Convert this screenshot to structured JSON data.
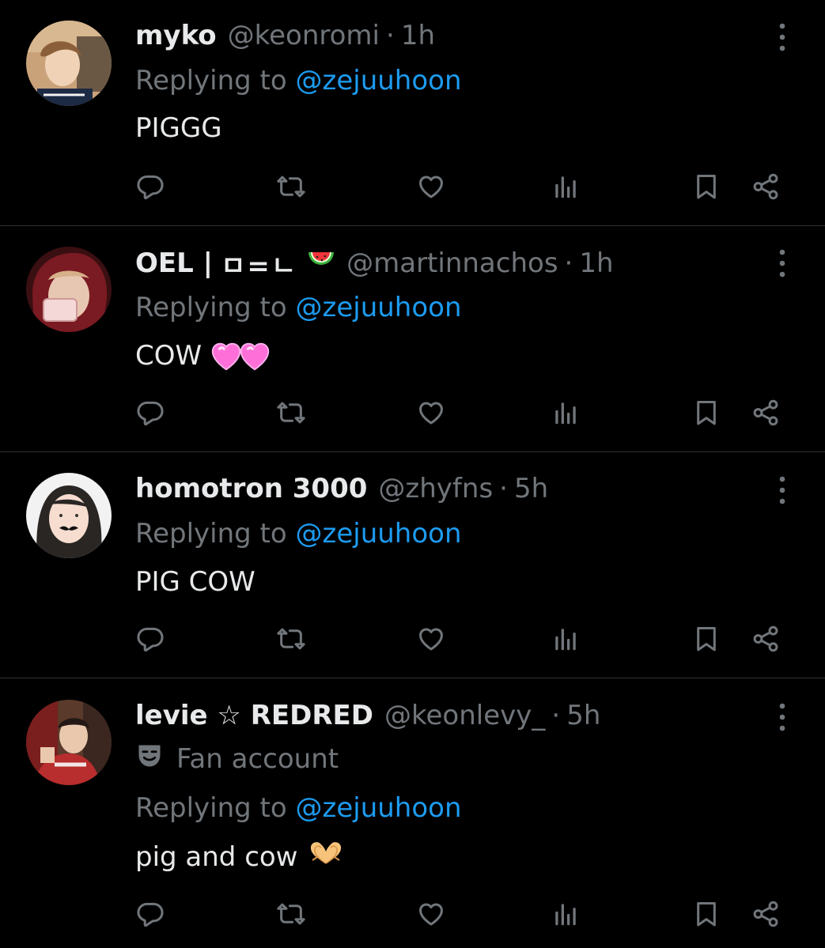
{
  "colors": {
    "background": "#000000",
    "text": "#e7e9ea",
    "muted": "#71767b",
    "link": "#1d9bf0",
    "divider": "#2f3336"
  },
  "replies": [
    {
      "display_name": "myko",
      "handle": "@keonromi",
      "separator": "·",
      "time": "1h",
      "replying_label": "Replying to",
      "replying_handle": "@zejuuhoon",
      "text": "PIGGG"
    },
    {
      "display_name": "OEL |",
      "name_symbols": "ㅁ=ㄴ",
      "name_emoji": "watermelon-emoji",
      "handle": "@martinnachos",
      "separator": "·",
      "time": "1h",
      "replying_label": "Replying to",
      "replying_handle": "@zejuuhoon",
      "text": "COW",
      "text_emoji": "two-pink-hearts-emoji"
    },
    {
      "display_name": "homotron 3000",
      "handle": "@zhyfns",
      "separator": "·",
      "time": "5h",
      "replying_label": "Replying to",
      "replying_handle": "@zejuuhoon",
      "text": "PIG COW"
    },
    {
      "display_name": "levie ☆ REDRED",
      "handle": "@keonlevy_",
      "separator": "·",
      "time": "5h",
      "badge_icon": "theater-masks-icon",
      "badge_label": "Fan account",
      "replying_label": "Replying to",
      "replying_handle": "@zejuuhoon",
      "text": "pig and cow",
      "text_emoji": "heart-hands-emoji"
    }
  ],
  "actions": [
    "reply-icon",
    "repost-icon",
    "like-icon",
    "views-icon",
    "bookmark-icon",
    "share-icon"
  ]
}
